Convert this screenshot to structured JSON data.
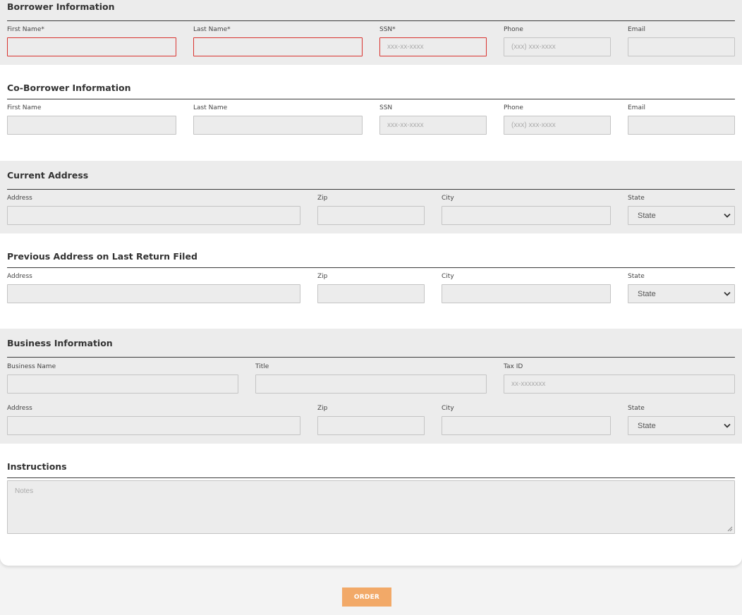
{
  "borrower": {
    "title": "Borrower Information",
    "first_name_label": "First Name*",
    "last_name_label": "Last Name*",
    "ssn_label": "SSN*",
    "ssn_placeholder": "xxx-xx-xxxx",
    "phone_label": "Phone",
    "phone_placeholder": "(xxx) xxx-xxxx",
    "email_label": "Email"
  },
  "co_borrower": {
    "title": "Co-Borrower Information",
    "first_name_label": "First Name",
    "last_name_label": "Last Name",
    "ssn_label": "SSN",
    "ssn_placeholder": "xxx-xx-xxxx",
    "phone_label": "Phone",
    "phone_placeholder": "(xxx) xxx-xxxx",
    "email_label": "Email"
  },
  "current_address": {
    "title": "Current Address",
    "address_label": "Address",
    "zip_label": "Zip",
    "city_label": "City",
    "state_label": "State",
    "state_value": "State"
  },
  "previous_address": {
    "title": "Previous Address on Last Return Filed",
    "address_label": "Address",
    "zip_label": "Zip",
    "city_label": "City",
    "state_label": "State",
    "state_value": "State"
  },
  "business": {
    "title": "Business Information",
    "business_name_label": "Business Name",
    "title_label": "Title",
    "tax_id_label": "Tax ID",
    "tax_id_placeholder": "xx-xxxxxxx",
    "address_label": "Address",
    "zip_label": "Zip",
    "city_label": "City",
    "state_label": "State",
    "state_value": "State"
  },
  "instructions": {
    "title": "Instructions",
    "notes_placeholder": "Notes"
  },
  "actions": {
    "order_label": "ORDER"
  },
  "colors": {
    "error_border": "#d9332f",
    "order_button": "#f2a968",
    "band_grey": "#ececec"
  }
}
